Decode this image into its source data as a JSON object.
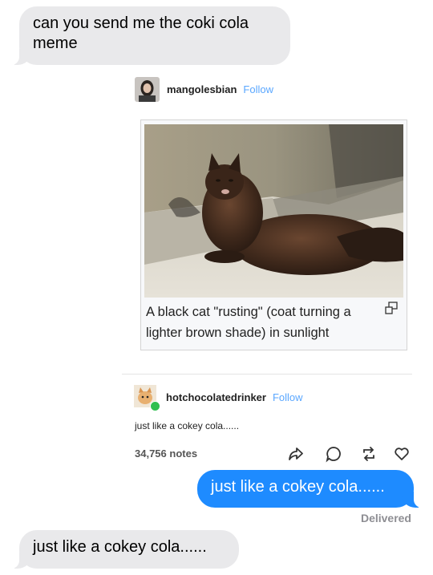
{
  "messages": {
    "incoming_1": "can you send me the coki cola meme",
    "outgoing_1": "just like a cokey cola......",
    "incoming_2": "just like a cokey cola......",
    "status": "Delivered"
  },
  "post": {
    "original": {
      "username": "mangolesbian",
      "follow_label": "Follow",
      "caption": "A black cat \"rusting\" (coat turning a lighter brown shade) in sunlight"
    },
    "reblog": {
      "username": "hotchocolatedrinker",
      "follow_label": "Follow",
      "text": "just like a cokey cola......"
    },
    "notes": "34,756 notes",
    "actions": [
      "share-icon",
      "reply-icon",
      "reblog-icon",
      "like-icon"
    ]
  },
  "colors": {
    "imessage_blue": "#1e8bff",
    "incoming_gray": "#e9e9eb",
    "follow_blue": "#5aa7ff"
  }
}
